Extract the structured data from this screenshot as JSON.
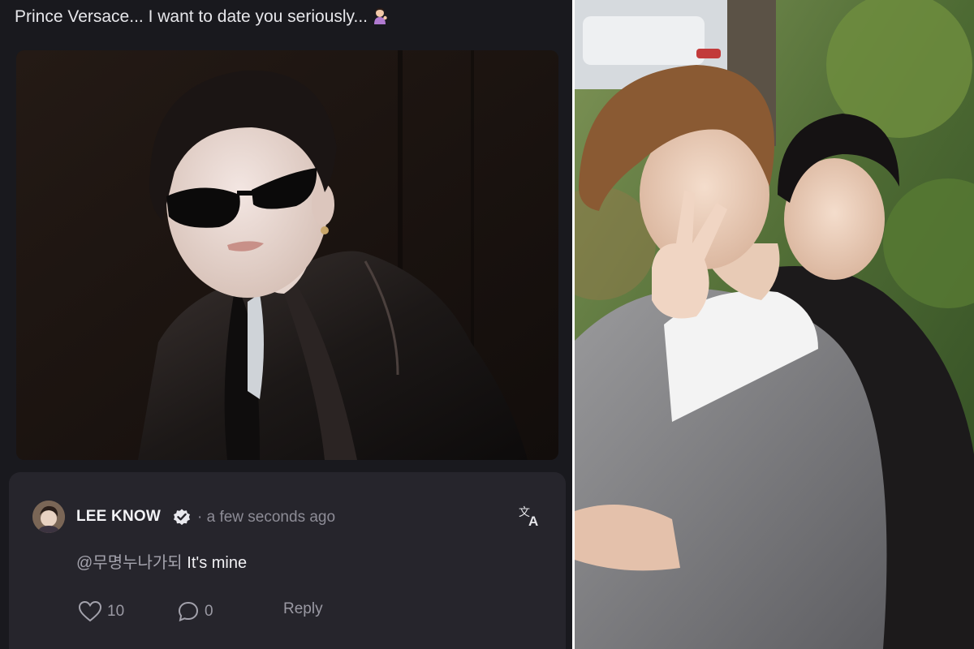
{
  "post": {
    "title": "Prince Versace... I want to date you seriously...",
    "title_emoji": "person-tipping-hand-emoji"
  },
  "comment": {
    "username": "LEE KNOW",
    "timestamp": "· a few seconds ago",
    "mention": "@무명누나가되",
    "text": " It's mine",
    "likes": "10",
    "replies": "0",
    "reply_label": "Reply"
  },
  "icons": {
    "verified": "verified-badge-icon",
    "translate": "translate-icon",
    "like": "heart-icon",
    "comment": "comment-bubble-icon"
  },
  "colors": {
    "background": "#19191e",
    "card": "#26252c",
    "text": "#f0f0f3",
    "muted": "#8d8c96"
  }
}
